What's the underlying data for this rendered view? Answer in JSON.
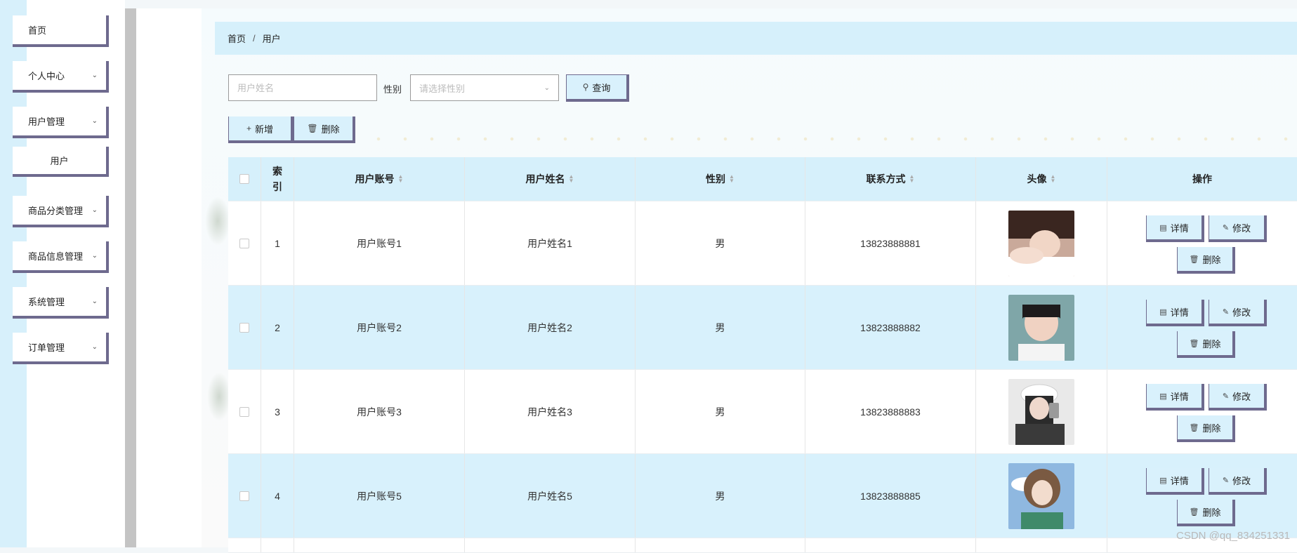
{
  "sidebar": {
    "items": [
      {
        "label": "首页",
        "has_chevron": false
      },
      {
        "label": "个人中心",
        "has_chevron": true
      },
      {
        "label": "用户管理",
        "has_chevron": true
      },
      {
        "label": "用户",
        "has_chevron": false,
        "submenu": true
      },
      {
        "label": "商品分类管理",
        "has_chevron": true
      },
      {
        "label": "商品信息管理",
        "has_chevron": true
      },
      {
        "label": "系统管理",
        "has_chevron": true
      },
      {
        "label": "订单管理",
        "has_chevron": true
      }
    ]
  },
  "breadcrumb": {
    "home": "首页",
    "separator": "/",
    "current": "用户"
  },
  "search": {
    "name_placeholder": "用户姓名",
    "name_value": "",
    "gender_label": "性别",
    "gender_placeholder": "请选择性别",
    "query_label": "查询"
  },
  "toolbar": {
    "add_label": "新增",
    "delete_label": "删除"
  },
  "table": {
    "headers": {
      "index": "索引",
      "index_line1": "索",
      "index_line2": "引",
      "account": "用户账号",
      "name": "用户姓名",
      "gender": "性别",
      "phone": "联系方式",
      "avatar": "头像",
      "ops": "操作"
    },
    "rows": [
      {
        "index": "1",
        "account": "用户账号1",
        "name": "用户姓名1",
        "gender": "男",
        "phone": "13823888881",
        "avatar": "avatar-photo-1"
      },
      {
        "index": "2",
        "account": "用户账号2",
        "name": "用户姓名2",
        "gender": "男",
        "phone": "13823888882",
        "avatar": "avatar-photo-2"
      },
      {
        "index": "3",
        "account": "用户账号3",
        "name": "用户姓名3",
        "gender": "男",
        "phone": "13823888883",
        "avatar": "avatar-photo-3"
      },
      {
        "index": "4",
        "account": "用户账号5",
        "name": "用户姓名5",
        "gender": "男",
        "phone": "13823888885",
        "avatar": "avatar-photo-4"
      }
    ],
    "op_labels": {
      "detail": "详情",
      "edit": "修改",
      "delete": "删除"
    }
  },
  "watermark": "CSDN @qq_834251331",
  "colors": {
    "accent_light": "#d6f0fb",
    "button_border": "#6e6a8e",
    "row_alt": "#d8f1fc"
  }
}
